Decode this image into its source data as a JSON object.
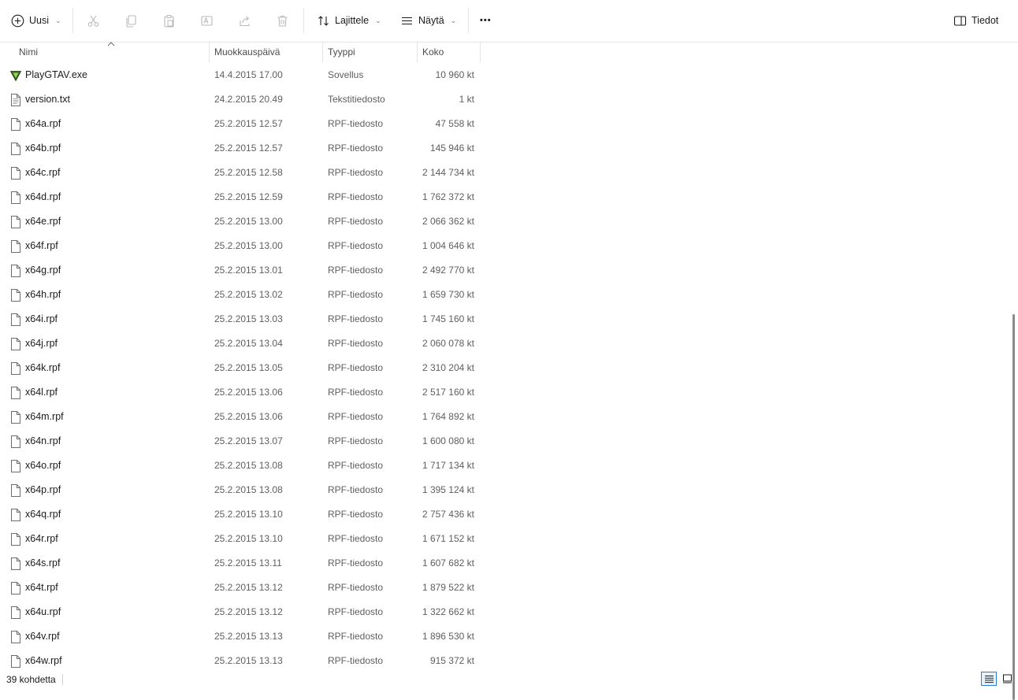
{
  "toolbar": {
    "new_label": "Uusi",
    "sort_label": "Lajittele",
    "view_label": "Näytä",
    "more_label": "•••",
    "details_label": "Tiedot"
  },
  "columns": {
    "name": "Nimi",
    "modified": "Muokkauspäivä",
    "type": "Tyyppi",
    "size": "Koko"
  },
  "files": [
    {
      "name": "PlayGTAV.exe",
      "date": "14.4.2015 17.00",
      "type": "Sovellus",
      "size": "10 960 kt",
      "icon": "gta-v-app-icon"
    },
    {
      "name": "version.txt",
      "date": "24.2.2015 20.49",
      "type": "Tekstitiedosto",
      "size": "1 kt",
      "icon": "text-file-icon"
    },
    {
      "name": "x64a.rpf",
      "date": "25.2.2015 12.57",
      "type": "RPF-tiedosto",
      "size": "47 558 kt",
      "icon": "file-icon"
    },
    {
      "name": "x64b.rpf",
      "date": "25.2.2015 12.57",
      "type": "RPF-tiedosto",
      "size": "145 946 kt",
      "icon": "file-icon"
    },
    {
      "name": "x64c.rpf",
      "date": "25.2.2015 12.58",
      "type": "RPF-tiedosto",
      "size": "2 144 734 kt",
      "icon": "file-icon"
    },
    {
      "name": "x64d.rpf",
      "date": "25.2.2015 12.59",
      "type": "RPF-tiedosto",
      "size": "1 762 372 kt",
      "icon": "file-icon"
    },
    {
      "name": "x64e.rpf",
      "date": "25.2.2015 13.00",
      "type": "RPF-tiedosto",
      "size": "2 066 362 kt",
      "icon": "file-icon"
    },
    {
      "name": "x64f.rpf",
      "date": "25.2.2015 13.00",
      "type": "RPF-tiedosto",
      "size": "1 004 646 kt",
      "icon": "file-icon"
    },
    {
      "name": "x64g.rpf",
      "date": "25.2.2015 13.01",
      "type": "RPF-tiedosto",
      "size": "2 492 770 kt",
      "icon": "file-icon"
    },
    {
      "name": "x64h.rpf",
      "date": "25.2.2015 13.02",
      "type": "RPF-tiedosto",
      "size": "1 659 730 kt",
      "icon": "file-icon"
    },
    {
      "name": "x64i.rpf",
      "date": "25.2.2015 13.03",
      "type": "RPF-tiedosto",
      "size": "1 745 160 kt",
      "icon": "file-icon"
    },
    {
      "name": "x64j.rpf",
      "date": "25.2.2015 13.04",
      "type": "RPF-tiedosto",
      "size": "2 060 078 kt",
      "icon": "file-icon"
    },
    {
      "name": "x64k.rpf",
      "date": "25.2.2015 13.05",
      "type": "RPF-tiedosto",
      "size": "2 310 204 kt",
      "icon": "file-icon"
    },
    {
      "name": "x64l.rpf",
      "date": "25.2.2015 13.06",
      "type": "RPF-tiedosto",
      "size": "2 517 160 kt",
      "icon": "file-icon"
    },
    {
      "name": "x64m.rpf",
      "date": "25.2.2015 13.06",
      "type": "RPF-tiedosto",
      "size": "1 764 892 kt",
      "icon": "file-icon"
    },
    {
      "name": "x64n.rpf",
      "date": "25.2.2015 13.07",
      "type": "RPF-tiedosto",
      "size": "1 600 080 kt",
      "icon": "file-icon"
    },
    {
      "name": "x64o.rpf",
      "date": "25.2.2015 13.08",
      "type": "RPF-tiedosto",
      "size": "1 717 134 kt",
      "icon": "file-icon"
    },
    {
      "name": "x64p.rpf",
      "date": "25.2.2015 13.08",
      "type": "RPF-tiedosto",
      "size": "1 395 124 kt",
      "icon": "file-icon"
    },
    {
      "name": "x64q.rpf",
      "date": "25.2.2015 13.10",
      "type": "RPF-tiedosto",
      "size": "2 757 436 kt",
      "icon": "file-icon"
    },
    {
      "name": "x64r.rpf",
      "date": "25.2.2015 13.10",
      "type": "RPF-tiedosto",
      "size": "1 671 152 kt",
      "icon": "file-icon"
    },
    {
      "name": "x64s.rpf",
      "date": "25.2.2015 13.11",
      "type": "RPF-tiedosto",
      "size": "1 607 682 kt",
      "icon": "file-icon"
    },
    {
      "name": "x64t.rpf",
      "date": "25.2.2015 13.12",
      "type": "RPF-tiedosto",
      "size": "1 879 522 kt",
      "icon": "file-icon"
    },
    {
      "name": "x64u.rpf",
      "date": "25.2.2015 13.12",
      "type": "RPF-tiedosto",
      "size": "1 322 662 kt",
      "icon": "file-icon"
    },
    {
      "name": "x64v.rpf",
      "date": "25.2.2015 13.13",
      "type": "RPF-tiedosto",
      "size": "1 896 530 kt",
      "icon": "file-icon"
    },
    {
      "name": "x64w.rpf",
      "date": "25.2.2015 13.13",
      "type": "RPF-tiedosto",
      "size": "915 372 kt",
      "icon": "file-icon"
    }
  ],
  "status": {
    "item_count": "39 kohdetta"
  }
}
